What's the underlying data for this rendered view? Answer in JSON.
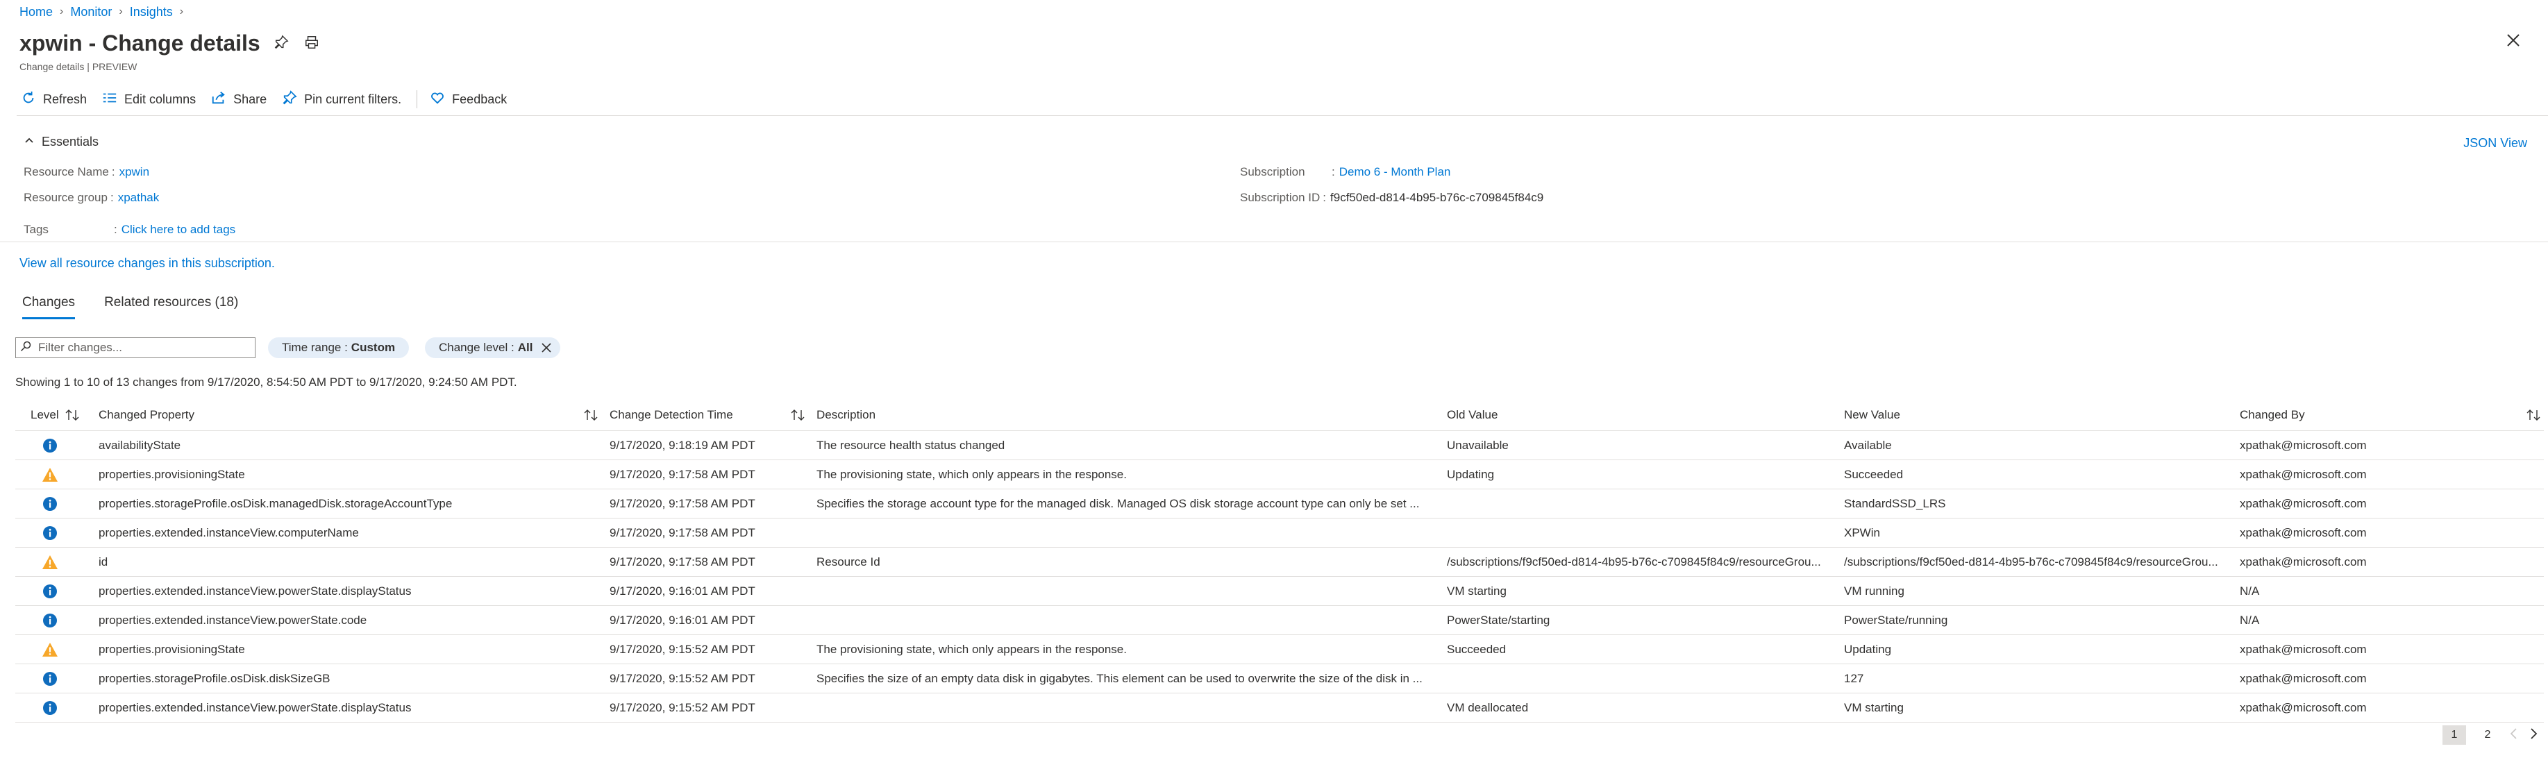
{
  "breadcrumb": {
    "items": [
      "Home",
      "Monitor",
      "Insights"
    ]
  },
  "header": {
    "title": "xpwin - Change details",
    "subtitle": "Change details | PREVIEW"
  },
  "toolbar": {
    "refresh": "Refresh",
    "edit_columns": "Edit columns",
    "share": "Share",
    "pin_filters": "Pin current filters.",
    "feedback": "Feedback"
  },
  "essentials": {
    "heading": "Essentials",
    "json_view": "JSON View",
    "resource_name_label": "Resource Name",
    "resource_name_value": "xpwin",
    "resource_group_label": "Resource group",
    "resource_group_value": "xpathak",
    "tags_label": "Tags",
    "tags_value": "Click here to add tags",
    "subscription_label": "Subscription",
    "subscription_value": "Demo 6 - Month Plan",
    "subscription_id_label": "Subscription ID",
    "subscription_id_value": "f9cf50ed-d814-4b95-b76c-c709845f84c9"
  },
  "view_all_link": "View all resource changes in this subscription.",
  "tabs": {
    "changes": "Changes",
    "related": "Related resources (18)"
  },
  "filters": {
    "search_placeholder": "Filter changes...",
    "time_range_label": "Time range :",
    "time_range_value": "Custom",
    "change_level_label": "Change level :",
    "change_level_value": "All"
  },
  "showing_text": "Showing 1 to 10 of 13 changes from 9/17/2020, 8:54:50 AM PDT to 9/17/2020, 9:24:50 AM PDT.",
  "table": {
    "headers": {
      "level": "Level",
      "property": "Changed Property",
      "time": "Change Detection Time",
      "description": "Description",
      "old": "Old Value",
      "new": "New Value",
      "by": "Changed By"
    },
    "rows": [
      {
        "level": "info",
        "property": "availabilityState",
        "time": "9/17/2020, 9:18:19 AM PDT",
        "description": "The resource health status changed",
        "old": "Unavailable",
        "new": "Available",
        "by": "xpathak@microsoft.com"
      },
      {
        "level": "warning",
        "property": "properties.provisioningState",
        "time": "9/17/2020, 9:17:58 AM PDT",
        "description": "The provisioning state, which only appears in the response.",
        "old": "Updating",
        "new": "Succeeded",
        "by": "xpathak@microsoft.com"
      },
      {
        "level": "info",
        "property": "properties.storageProfile.osDisk.managedDisk.storageAccountType",
        "time": "9/17/2020, 9:17:58 AM PDT",
        "description": "Specifies the storage account type for the managed disk. Managed OS disk storage account type can only be set ...",
        "old": "",
        "new": "StandardSSD_LRS",
        "by": "xpathak@microsoft.com"
      },
      {
        "level": "info",
        "property": "properties.extended.instanceView.computerName",
        "time": "9/17/2020, 9:17:58 AM PDT",
        "description": "",
        "old": "",
        "new": "XPWin",
        "by": "xpathak@microsoft.com"
      },
      {
        "level": "warning",
        "property": "id",
        "time": "9/17/2020, 9:17:58 AM PDT",
        "description": "Resource Id",
        "old": "/subscriptions/f9cf50ed-d814-4b95-b76c-c709845f84c9/resourceGrou...",
        "new": "/subscriptions/f9cf50ed-d814-4b95-b76c-c709845f84c9/resourceGrou...",
        "by": "xpathak@microsoft.com"
      },
      {
        "level": "info",
        "property": "properties.extended.instanceView.powerState.displayStatus",
        "time": "9/17/2020, 9:16:01 AM PDT",
        "description": "",
        "old": "VM starting",
        "new": "VM running",
        "by": "N/A"
      },
      {
        "level": "info",
        "property": "properties.extended.instanceView.powerState.code",
        "time": "9/17/2020, 9:16:01 AM PDT",
        "description": "",
        "old": "PowerState/starting",
        "new": "PowerState/running",
        "by": "N/A"
      },
      {
        "level": "warning",
        "property": "properties.provisioningState",
        "time": "9/17/2020, 9:15:52 AM PDT",
        "description": "The provisioning state, which only appears in the response.",
        "old": "Succeeded",
        "new": "Updating",
        "by": "xpathak@microsoft.com"
      },
      {
        "level": "info",
        "property": "properties.storageProfile.osDisk.diskSizeGB",
        "time": "9/17/2020, 9:15:52 AM PDT",
        "description": "Specifies the size of an empty data disk in gigabytes. This element can be used to overwrite the size of the disk in ...",
        "old": "",
        "new": "127",
        "by": "xpathak@microsoft.com"
      },
      {
        "level": "info",
        "property": "properties.extended.instanceView.powerState.displayStatus",
        "time": "9/17/2020, 9:15:52 AM PDT",
        "description": "",
        "old": "VM deallocated",
        "new": "VM starting",
        "by": "xpathak@microsoft.com"
      }
    ]
  },
  "pager": {
    "pages": [
      "1",
      "2"
    ],
    "current": "1"
  },
  "colors": {
    "accent": "#0078d4",
    "info": "#0f6cbd",
    "warning": "#f7a72a"
  }
}
